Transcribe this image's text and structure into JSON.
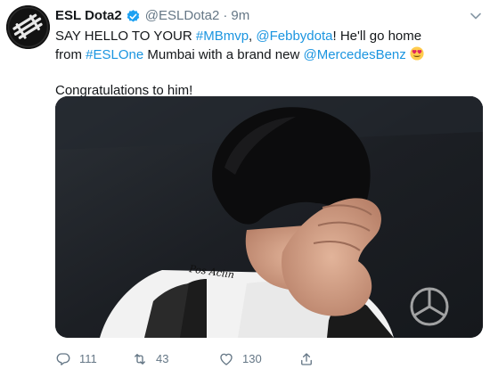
{
  "tweet": {
    "author": {
      "display_name": "ESL Dota2",
      "verified": true,
      "handle": "@ESLDota2",
      "separator": "·",
      "time": "9m",
      "avatar_icon": "esl-logo-icon"
    },
    "text": {
      "lead": "SAY HELLO TO YOUR ",
      "hashtag_1": "#MBmvp",
      "comma": ", ",
      "mention_1": "@Febbydota",
      "middle": "! He'll go home from ",
      "hashtag_2": "#ESLOne",
      "middle_2": " Mumbai with a brand new ",
      "mention_2": "@MercedesBenz",
      "emoji": "heart-eyes-emoji",
      "congrats": "Congratulations to him!"
    },
    "media": {
      "overlay_text": "Pos Aciin"
    },
    "actions": {
      "reply_count": "111",
      "retweet_count": "43",
      "like_count": "130"
    }
  },
  "colors": {
    "link": "#1b95e0",
    "text": "#14171a",
    "secondary": "#657786",
    "verified": "#1da1f2"
  }
}
